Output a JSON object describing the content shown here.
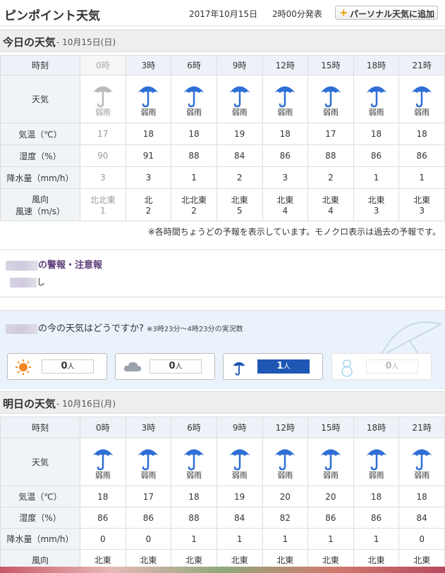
{
  "header": {
    "title": "ピンポイント天気",
    "date": "2017年10月15日",
    "issued": "2時00分発表",
    "add_button": "パーソナル天気に追加"
  },
  "today": {
    "title": "今日の天気",
    "date": "- 10月15日(日)",
    "rows": {
      "time": "時刻",
      "weather": "天気",
      "temp": "気温（℃）",
      "humidity": "湿度（%）",
      "precip": "降水量（mm/h）",
      "wind_dir": "風向",
      "wind_speed": "風速（m/s）"
    },
    "slots": [
      {
        "time": "0時",
        "weather": "弱雨",
        "icon": "umbrella-icon",
        "temp": "17",
        "humidity": "90",
        "precip": "3",
        "wind_dir": "北北東",
        "wind_speed": "1",
        "past": true
      },
      {
        "time": "3時",
        "weather": "弱雨",
        "icon": "umbrella-icon",
        "temp": "18",
        "humidity": "91",
        "precip": "3",
        "wind_dir": "北",
        "wind_speed": "2"
      },
      {
        "time": "6時",
        "weather": "弱雨",
        "icon": "umbrella-icon",
        "temp": "18",
        "humidity": "88",
        "precip": "1",
        "wind_dir": "北北東",
        "wind_speed": "2"
      },
      {
        "time": "9時",
        "weather": "弱雨",
        "icon": "umbrella-icon",
        "temp": "19",
        "humidity": "84",
        "precip": "2",
        "wind_dir": "北東",
        "wind_speed": "5"
      },
      {
        "time": "12時",
        "weather": "弱雨",
        "icon": "umbrella-icon",
        "temp": "18",
        "humidity": "86",
        "precip": "3",
        "wind_dir": "北東",
        "wind_speed": "4"
      },
      {
        "time": "15時",
        "weather": "弱雨",
        "icon": "umbrella-icon",
        "temp": "17",
        "humidity": "88",
        "precip": "2",
        "wind_dir": "北東",
        "wind_speed": "4"
      },
      {
        "time": "18時",
        "weather": "弱雨",
        "icon": "umbrella-icon",
        "temp": "18",
        "humidity": "86",
        "precip": "1",
        "wind_dir": "北東",
        "wind_speed": "3"
      },
      {
        "time": "21時",
        "weather": "弱雨",
        "icon": "umbrella-icon",
        "temp": "18",
        "humidity": "86",
        "precip": "1",
        "wind_dir": "北東",
        "wind_speed": "3"
      }
    ],
    "note": "※各時間ちょうどの予報を表示しています。モノクロ表示は過去の予報です。"
  },
  "alert": {
    "title": "の警報・注意報",
    "body": "し"
  },
  "now": {
    "question": "の今の天気はどうですか?",
    "range_note": "※3時23分～4時23分の実況数",
    "unit": "人",
    "votes": [
      {
        "icon": "sun-icon",
        "count": "0",
        "color": "#f08a24"
      },
      {
        "icon": "cloud-icon",
        "count": "0",
        "color": "#9aa2ab"
      },
      {
        "icon": "umbrella-icon",
        "count": "1",
        "color": "#1f57b5"
      },
      {
        "icon": "snowman-icon",
        "count": "0",
        "color": "#a8d8ef"
      }
    ]
  },
  "tomorrow": {
    "title": "明日の天気",
    "date": "- 10月16日(月)",
    "rows": {
      "time": "時刻",
      "weather": "天気",
      "temp": "気温（℃）",
      "humidity": "湿度（%）",
      "precip": "降水量（mm/h）",
      "wind_dir": "風向"
    },
    "slots": [
      {
        "time": "0時",
        "weather": "弱雨",
        "icon": "umbrella-icon",
        "temp": "18",
        "humidity": "86",
        "precip": "0",
        "wind_dir": "北東"
      },
      {
        "time": "3時",
        "weather": "弱雨",
        "icon": "umbrella-icon",
        "temp": "17",
        "humidity": "86",
        "precip": "0",
        "wind_dir": "北東"
      },
      {
        "time": "6時",
        "weather": "弱雨",
        "icon": "umbrella-icon",
        "temp": "18",
        "humidity": "88",
        "precip": "1",
        "wind_dir": "北東"
      },
      {
        "time": "9時",
        "weather": "弱雨",
        "icon": "umbrella-icon",
        "temp": "19",
        "humidity": "84",
        "precip": "1",
        "wind_dir": "北東"
      },
      {
        "time": "12時",
        "weather": "弱雨",
        "icon": "umbrella-icon",
        "temp": "20",
        "humidity": "82",
        "precip": "1",
        "wind_dir": "北東"
      },
      {
        "time": "15時",
        "weather": "弱雨",
        "icon": "umbrella-icon",
        "temp": "20",
        "humidity": "86",
        "precip": "1",
        "wind_dir": "北東"
      },
      {
        "time": "18時",
        "weather": "弱雨",
        "icon": "umbrella-icon",
        "temp": "18",
        "humidity": "86",
        "precip": "1",
        "wind_dir": "北東"
      },
      {
        "time": "21時",
        "weather": "弱雨",
        "icon": "umbrella-icon",
        "temp": "18",
        "humidity": "84",
        "precip": "0",
        "wind_dir": "北東"
      }
    ]
  },
  "colors": {
    "rain_blue": "#2f6fd6",
    "past_gray": "#bbbbbb"
  }
}
